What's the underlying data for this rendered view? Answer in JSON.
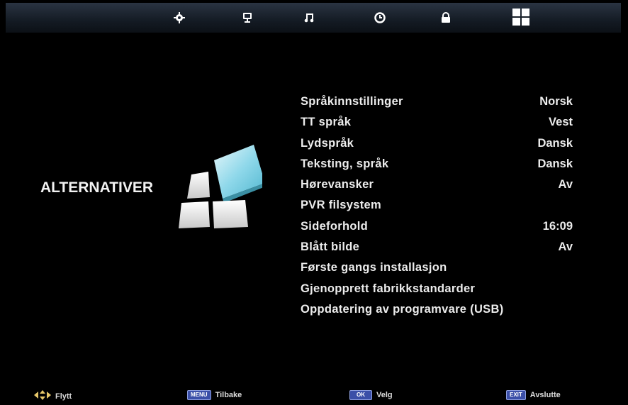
{
  "topbar": {
    "icons": [
      "picture-settings-icon",
      "channel-icon",
      "music-note-icon",
      "clock-icon",
      "lock-icon",
      "options-grid-icon"
    ]
  },
  "section": {
    "title": "ALTERNATIVER"
  },
  "menu": {
    "items": [
      {
        "label": "Språkinnstillinger",
        "value": "Norsk"
      },
      {
        "label": "TT språk",
        "value": "Vest"
      },
      {
        "label": "Lydspråk",
        "value": "Dansk"
      },
      {
        "label": "Teksting, språk",
        "value": "Dansk"
      },
      {
        "label": "Hørevansker",
        "value": "Av"
      },
      {
        "label": "PVR filsystem",
        "value": ""
      },
      {
        "label": "Sideforhold",
        "value": "16:09"
      },
      {
        "label": "Blått bilde",
        "value": "Av"
      },
      {
        "label": "Første gangs installasjon",
        "value": ""
      },
      {
        "label": "Gjenopprett fabrikkstandarder",
        "value": ""
      },
      {
        "label": "Oppdatering av programvare (USB)",
        "value": ""
      }
    ]
  },
  "footer": {
    "move_label": "Flytt",
    "menu_key": "MENU",
    "back_label": "Tilbake",
    "ok_key": "OK",
    "select_label": "Velg",
    "exit_key": "EXIT",
    "exit_label": "Avslutte"
  },
  "colors": {
    "background": "#000000",
    "text": "#ececec",
    "key_bg": "#3b4fa8",
    "logo_accent": "#7fd3e6"
  }
}
